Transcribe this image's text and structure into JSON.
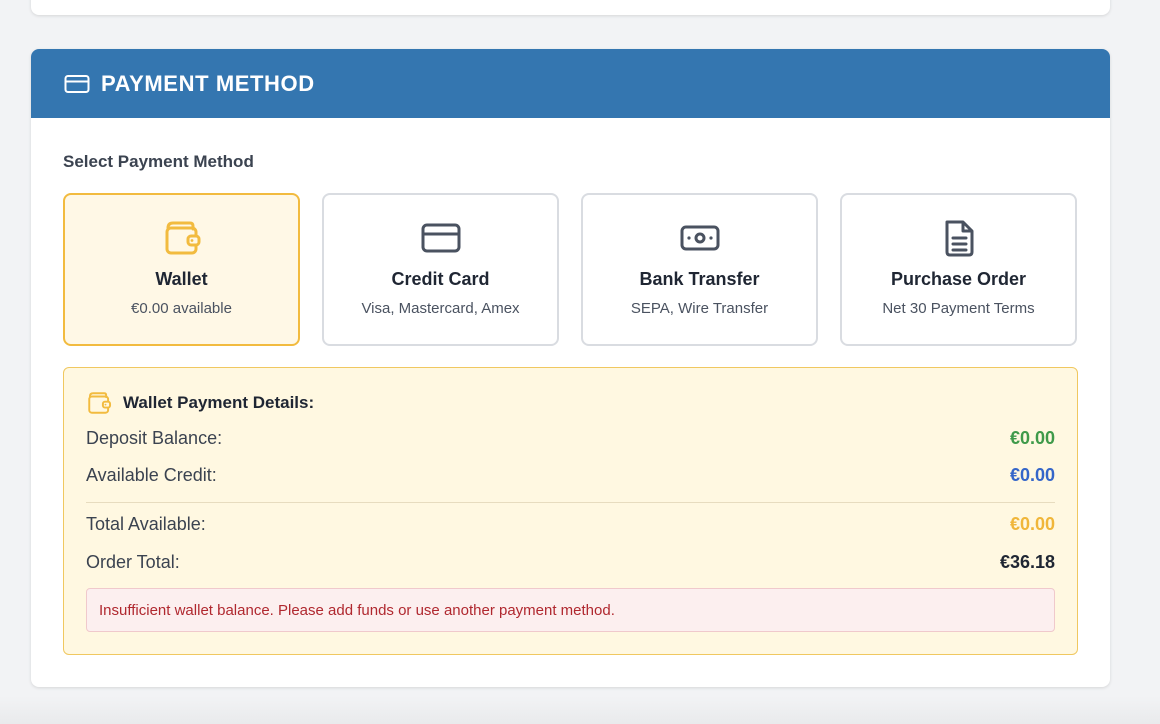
{
  "header": {
    "title": "PAYMENT METHOD",
    "icon": "credit-card-icon"
  },
  "select_label": "Select Payment Method",
  "methods": [
    {
      "title": "Wallet",
      "subtitle": "€0.00 available",
      "icon": "wallet-icon",
      "selected": true,
      "accent": "#f2bb3f"
    },
    {
      "title": "Credit Card",
      "subtitle": "Visa, Mastercard, Amex",
      "icon": "credit-card-icon",
      "selected": false
    },
    {
      "title": "Bank Transfer",
      "subtitle": "SEPA, Wire Transfer",
      "icon": "banknote-icon",
      "selected": false
    },
    {
      "title": "Purchase Order",
      "subtitle": "Net 30 Payment Terms",
      "icon": "document-icon",
      "selected": false
    }
  ],
  "wallet_details": {
    "title": "Wallet Payment Details:",
    "icon": "wallet-icon",
    "deposit_balance": {
      "label": "Deposit Balance:",
      "value": "€0.00",
      "color": "#3f9a4a"
    },
    "available_credit": {
      "label": "Available Credit:",
      "value": "€0.00",
      "color": "#3566c9"
    },
    "total_available": {
      "label": "Total Available:",
      "value": "€0.00",
      "color": "#f0b63a"
    },
    "order_total": {
      "label": "Order Total:",
      "value": "€36.18",
      "color": "#1f2633"
    },
    "error": "Insufficient wallet balance. Please add funds or use another payment method."
  }
}
